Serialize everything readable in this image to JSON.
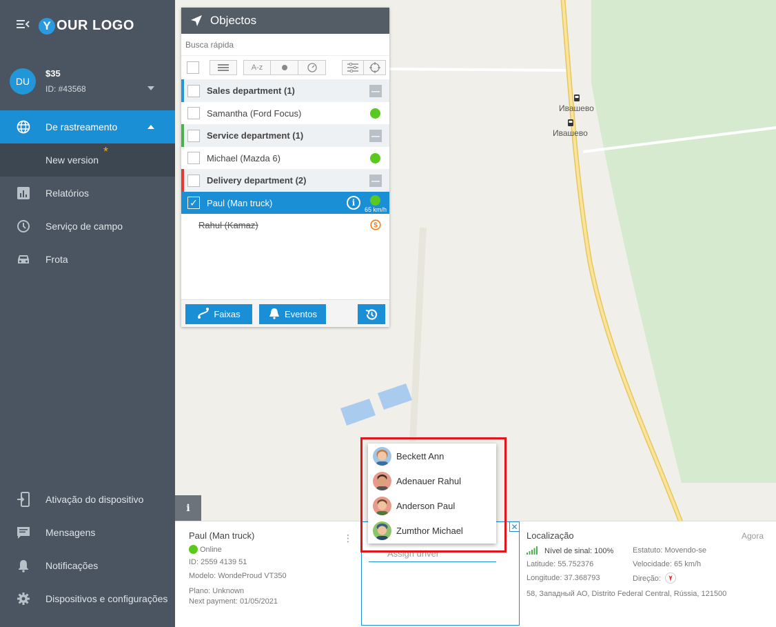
{
  "sidebar": {
    "logo": "YOUR LOGO",
    "logo_letter": "Y",
    "logo_rest": "OUR LOGO",
    "account": {
      "initials": "DU",
      "balance": "$35",
      "id": "ID: #43568"
    },
    "nav": [
      {
        "label": "De rastreamento",
        "icon": "globe-icon",
        "active": true
      },
      {
        "label": "New version",
        "sub": true,
        "badge": "*"
      },
      {
        "label": "Relatórios",
        "icon": "bar-chart-icon"
      },
      {
        "label": "Serviço de campo",
        "icon": "clock-icon"
      },
      {
        "label": "Frota",
        "icon": "car-icon"
      }
    ],
    "bottom_nav": [
      {
        "label": "Ativação do dispositivo",
        "icon": "device-activation-icon"
      },
      {
        "label": "Mensagens",
        "icon": "message-icon"
      },
      {
        "label": "Notificações",
        "icon": "bell-icon"
      },
      {
        "label": "Dispositivos e configurações",
        "icon": "gear-icon"
      }
    ]
  },
  "map": {
    "labels": [
      "Ивашево",
      "Ивашево"
    ]
  },
  "objects": {
    "title": "Objectos",
    "search_placeholder": "Busca rápida",
    "toolbar": {
      "sort_label": "A-z"
    },
    "groups": [
      {
        "name": "Sales department (1)",
        "color": "#2196d8",
        "items": [
          {
            "name": "Samantha (Ford Focus)",
            "status": "online"
          }
        ]
      },
      {
        "name": "Service department (1)",
        "color": "#4caf50",
        "items": [
          {
            "name": "Michael (Mazda 6)",
            "status": "online"
          }
        ]
      },
      {
        "name": "Delivery department (2)",
        "color": "#e53935",
        "items": [
          {
            "name": "Paul (Man truck)",
            "status": "online",
            "selected": true,
            "speed": "65 km/h"
          },
          {
            "name": "Rahul (Kamaz)",
            "status": "blocked"
          }
        ]
      }
    ],
    "footer": {
      "tracks": "Faixas",
      "events": "Eventos"
    }
  },
  "details": {
    "title": "Paul (Man truck)",
    "status": "Online",
    "id": "ID: 2559 4139 51",
    "model": "Modelo: WondeProud VT350",
    "plan": "Plano: Unknown",
    "next_payment": "Next payment: 01/05/2021",
    "assign_placeholder": "Assign driver"
  },
  "location": {
    "title": "Localização",
    "time": "Agora",
    "signal_label": "Nível de sinal:",
    "signal_value": "100%",
    "status_label": "Estatuto:",
    "status_value": "Movendo-se",
    "lat_label": "Latitude:",
    "lat_value": "55.752376",
    "speed_label": "Velocidade:",
    "speed_value": "65 km/h",
    "lon_label": "Longitude:",
    "lon_value": "37.368793",
    "dir_label": "Direção:",
    "address": "58, Западный АО, Distrito Federal Central, Rússia, 121500"
  },
  "drivers": [
    {
      "name": "Beckett Ann",
      "skin": "#f2c7a5",
      "hair": "#c8793a",
      "bg": "#9fc6e6"
    },
    {
      "name": "Adenauer Rahul",
      "skin": "#d9a27a",
      "hair": "#3b2a20",
      "bg": "#e89a8a"
    },
    {
      "name": "Anderson Paul",
      "skin": "#f0c3a0",
      "hair": "#6b4a2a",
      "bg": "#e89a8a"
    },
    {
      "name": "Zumthor Michael",
      "skin": "#f0c3a0",
      "hair": "#3a5d8a",
      "bg": "#8cc46a"
    }
  ]
}
